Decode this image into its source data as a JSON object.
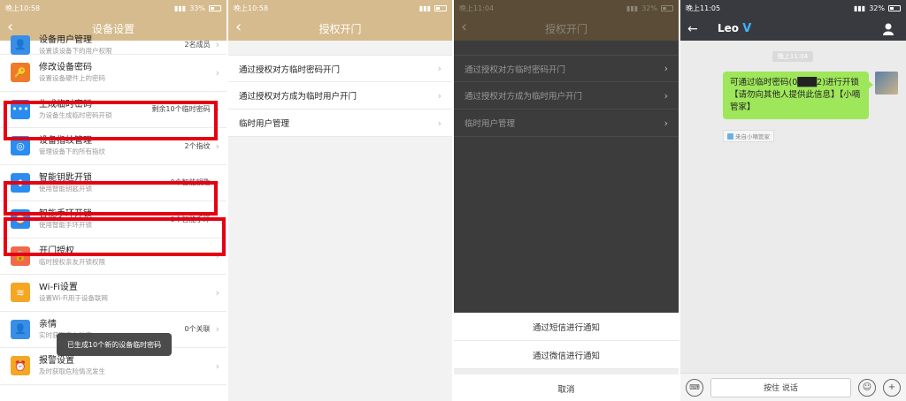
{
  "panel1": {
    "status_time": "晚上10:58",
    "battery": "33%",
    "title": "设备设置",
    "items": [
      {
        "title": "设备用户管理",
        "sub": "设置该设备下的用户权限",
        "meta": "2名成员",
        "icon": "user-icon",
        "color": "#3a8ee6"
      },
      {
        "title": "修改设备密码",
        "sub": "设置设备硬件上的密码",
        "meta": "",
        "icon": "key-icon",
        "color": "#f07a2a"
      },
      {
        "title": "生成临时密码",
        "sub": "为设备生成临时密码开锁",
        "meta": "剩余10个临时密码",
        "icon": "dots-icon",
        "color": "#2a8cf0"
      },
      {
        "title": "设备指纹管理",
        "sub": "管理设备下的所有指纹",
        "meta": "2个指纹",
        "icon": "fingerprint-icon",
        "color": "#2a8cf0"
      },
      {
        "title": "智能钥匙开锁",
        "sub": "使用智能钥匙开锁",
        "meta": "0个智能钥匙",
        "icon": "smart-key-icon",
        "color": "#2a8cf0"
      },
      {
        "title": "智能手环开锁",
        "sub": "使用智能手环开锁",
        "meta": "0个智能手环",
        "icon": "wristband-icon",
        "color": "#2a8cf0"
      },
      {
        "title": "开门授权",
        "sub": "临时授权亲友开锁权限",
        "meta": "",
        "icon": "lock-share-icon",
        "color": "#f06a4a"
      },
      {
        "title": "Wi-Fi设置",
        "sub": "设置Wi-Fi用于设备联网",
        "meta": "",
        "icon": "wifi-icon",
        "color": "#f5a623"
      },
      {
        "title": "亲情",
        "sub": "实时获取亲友动态",
        "meta": "0个关联",
        "icon": "family-icon",
        "color": "#3a8ee6"
      },
      {
        "title": "报警设置",
        "sub": "及时获取危险情况发生",
        "meta": "",
        "icon": "alarm-icon",
        "color": "#f5a623"
      }
    ],
    "toast": "已生成10个新的设备临时密码"
  },
  "panel2": {
    "status_time": "晚上10:58",
    "title": "授权开门",
    "items": [
      "通过授权对方临时密码开门",
      "通过授权对方成为临时用户开门",
      "临时用户管理"
    ]
  },
  "panel3": {
    "status_time": "晚上11:04",
    "battery": "32%",
    "title": "授权开门",
    "items": [
      "通过授权对方临时密码开门",
      "通过授权对方成为临时用户开门",
      "临时用户管理"
    ],
    "sheet": [
      "通过短信进行通知",
      "通过微信进行通知",
      "取消"
    ]
  },
  "panel4": {
    "status_time": "晚上11:05",
    "battery": "32%",
    "title": "Leo",
    "time_chip": "晚上11:04",
    "message": "可通过临时密码(0███2)进行开锁【请勿向其他人提供此信息】【小嘀管家】",
    "source": "来自小嘀管家",
    "voice_label": "按住 说话"
  },
  "colors": {
    "header_gold": "#d6bb8e",
    "highlight_red": "#e60012",
    "bubble_green": "#9fe75a",
    "chat_nav": "#393a3f"
  }
}
